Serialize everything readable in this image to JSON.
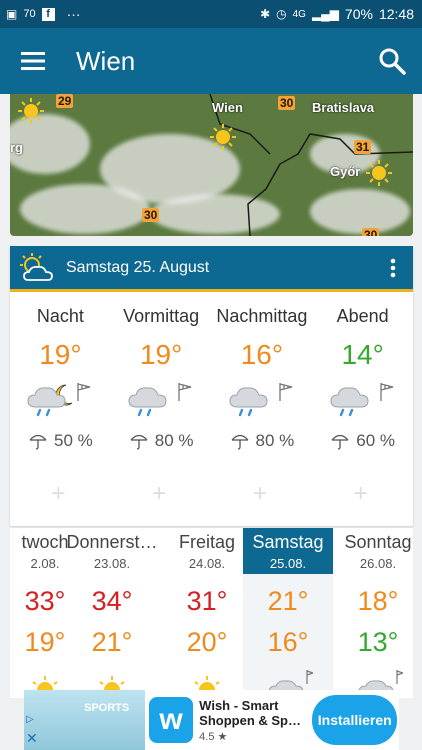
{
  "statusbar": {
    "left_battery": "70",
    "dots": "···",
    "signal": "4G",
    "battery": "70%",
    "time": "12:48"
  },
  "appbar": {
    "title": "Wien",
    "menu_icon": "hamburger-menu-icon",
    "search_icon": "search-icon"
  },
  "map": {
    "labels": [
      "Wien",
      "Bratislava",
      "Győr",
      "rg"
    ],
    "temps": [
      "29",
      "30",
      "31",
      "30",
      "30"
    ]
  },
  "today": {
    "date": "Samstag 25. August",
    "periods": [
      {
        "name": "Nacht",
        "temp": "19°",
        "color": "#f08a1c",
        "rain": "50 %",
        "icon": "moon-cloud-rain-icon"
      },
      {
        "name": "Vormittag",
        "temp": "19°",
        "color": "#f08a1c",
        "rain": "80 %",
        "icon": "cloud-rain-icon"
      },
      {
        "name": "Nachmittag",
        "temp": "16°",
        "color": "#f08a1c",
        "rain": "80 %",
        "icon": "cloud-rain-icon"
      },
      {
        "name": "Abend",
        "temp": "14°",
        "color": "#36a82e",
        "rain": "60 %",
        "icon": "cloud-rain-icon"
      }
    ]
  },
  "forecast": [
    {
      "name": "twoch",
      "date": "2.08.",
      "max": "33°",
      "min": "19°",
      "maxc": "#d62020",
      "minc": "#f08a1c"
    },
    {
      "name": "Donnerst…",
      "date": "23.08.",
      "max": "34°",
      "min": "21°",
      "maxc": "#d62020",
      "minc": "#f08a1c"
    },
    {
      "name": "Freitag",
      "date": "24.08.",
      "max": "31°",
      "min": "20°",
      "maxc": "#d62020",
      "minc": "#f08a1c"
    },
    {
      "name": "Samstag",
      "date": "25.08.",
      "max": "21°",
      "min": "16°",
      "maxc": "#f08a1c",
      "minc": "#f08a1c"
    },
    {
      "name": "Sonntag",
      "date": "26.08.",
      "max": "18°",
      "min": "13°",
      "maxc": "#f08a1c",
      "minc": "#36a82e"
    }
  ],
  "ad": {
    "sports": "SPORTS",
    "title": "Wish - Smart Shoppen & Sp…",
    "rating": "4.5 ★",
    "button": "Installieren"
  }
}
